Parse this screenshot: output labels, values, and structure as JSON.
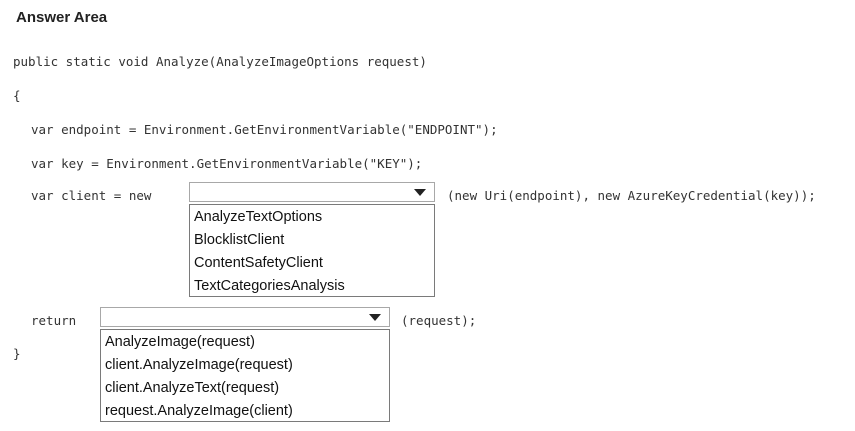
{
  "title": "Answer Area",
  "code": {
    "line1": "public static void Analyze(AnalyzeImageOptions request)",
    "open_brace": "{",
    "line_endpoint": "var endpoint = Environment.GetEnvironmentVariable(\"ENDPOINT\");",
    "line_key": "var key = Environment.GetEnvironmentVariable(\"KEY\");",
    "line_client_prefix": "var client = new",
    "line_client_suffix": "(new Uri(endpoint), new AzureKeyCredential(key));",
    "line_return_prefix": "return",
    "line_return_suffix": "(request);",
    "close_brace": "}"
  },
  "dropdown1": {
    "selected": "",
    "options": [
      "AnalyzeTextOptions",
      "BlocklistClient",
      "ContentSafetyClient",
      "TextCategoriesAnalysis"
    ]
  },
  "dropdown2": {
    "selected": "",
    "options": [
      "AnalyzeImage(request)",
      "client.AnalyzeImage(request)",
      "client.AnalyzeText(request)",
      "request.AnalyzeImage(client)"
    ]
  }
}
